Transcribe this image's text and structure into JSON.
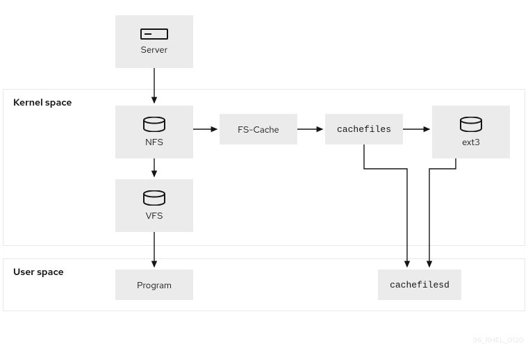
{
  "regions": {
    "kernel": {
      "label": "Kernel space"
    },
    "user": {
      "label": "User space"
    }
  },
  "nodes": {
    "server": {
      "label": "Server",
      "icon": "server"
    },
    "nfs": {
      "label": "NFS",
      "icon": "disk"
    },
    "vfs": {
      "label": "VFS",
      "icon": "disk"
    },
    "program": {
      "label": "Program",
      "icon": null
    },
    "fscache": {
      "label": "FS-Cache",
      "icon": null
    },
    "cachefiles": {
      "label": "cachefiles",
      "icon": null,
      "mono": true
    },
    "ext3": {
      "label": "ext3",
      "icon": "disk"
    },
    "cachefilesd": {
      "label": "cachefilesd",
      "icon": null,
      "mono": true
    }
  },
  "edges": [
    {
      "from": "server",
      "to": "nfs"
    },
    {
      "from": "nfs",
      "to": "fscache"
    },
    {
      "from": "fscache",
      "to": "cachefiles"
    },
    {
      "from": "cachefiles",
      "to": "ext3"
    },
    {
      "from": "nfs",
      "to": "vfs"
    },
    {
      "from": "vfs",
      "to": "program"
    },
    {
      "from": "cachefiles",
      "to": "cachefilesd"
    },
    {
      "from": "ext3",
      "to": "cachefilesd",
      "note": "routed-down"
    }
  ],
  "watermark": "96_RHEL_0120"
}
